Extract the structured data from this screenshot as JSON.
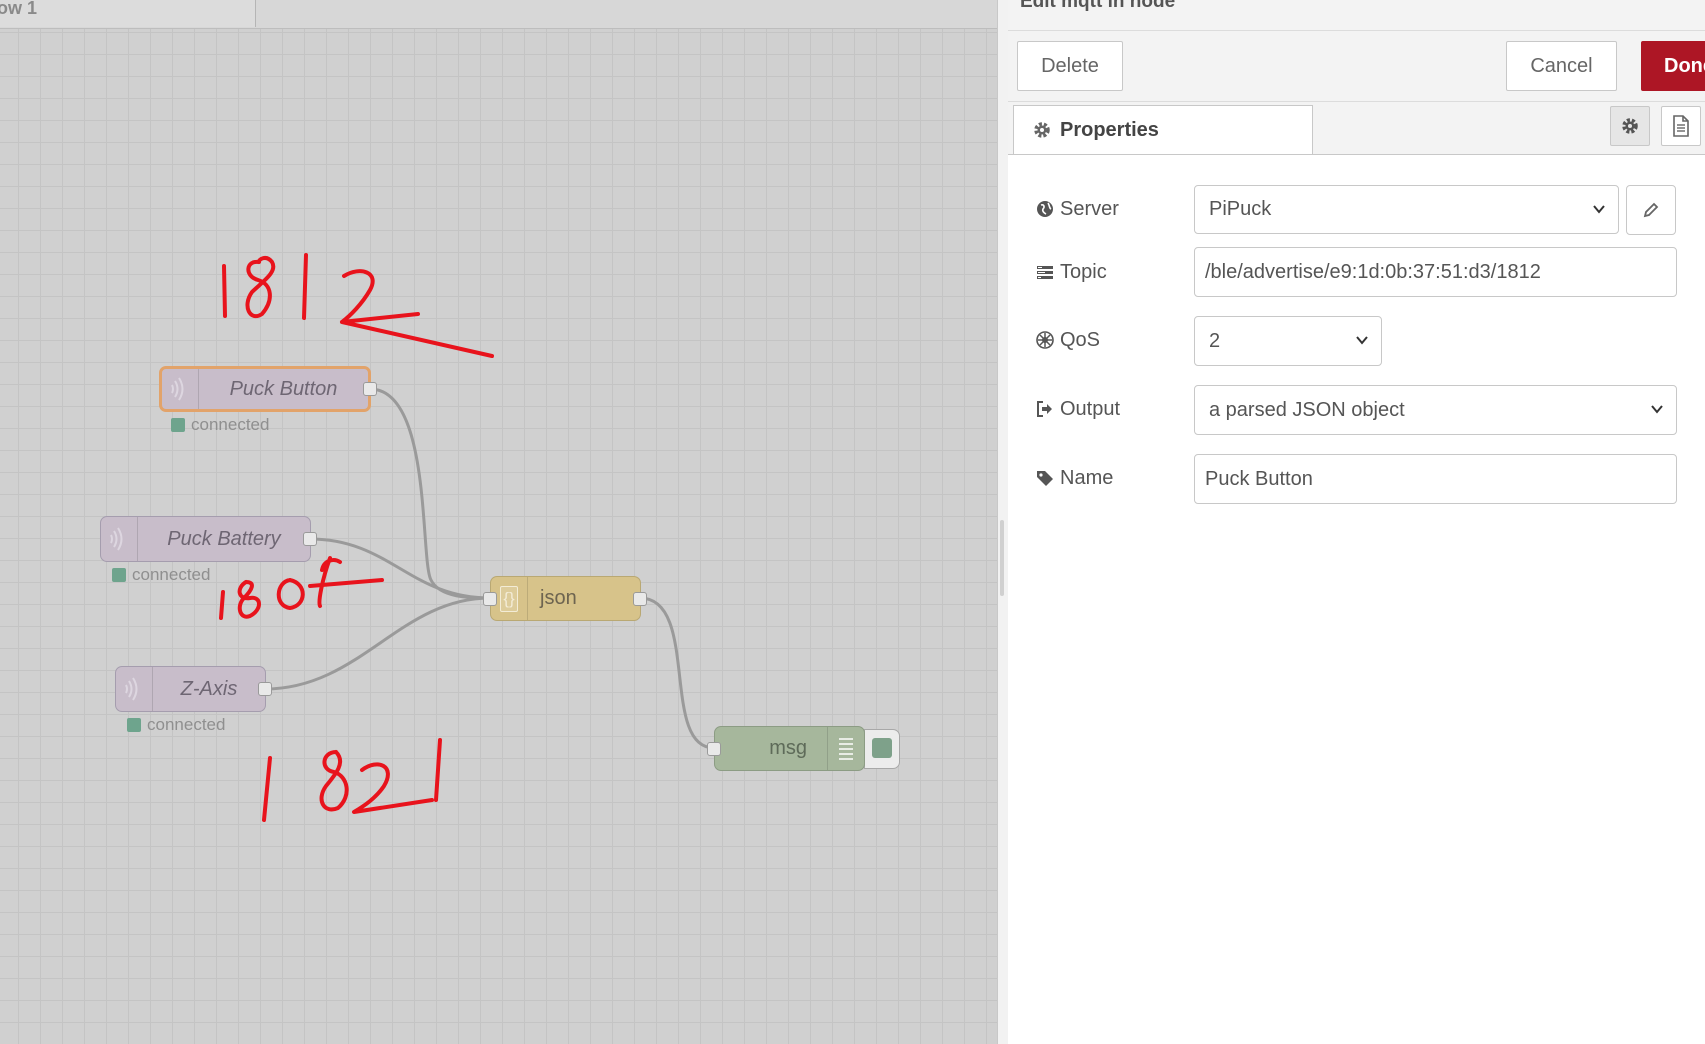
{
  "workspace": {
    "flow_tab_label": "ow 1",
    "nodes": {
      "puck_button": {
        "label": "Puck Button",
        "status": "connected"
      },
      "puck_battery": {
        "label": "Puck Battery",
        "status": "connected"
      },
      "z_axis": {
        "label": "Z-Axis",
        "status": "connected"
      },
      "json": {
        "label": "json",
        "icon": "{}"
      },
      "msg": {
        "label": "msg"
      }
    },
    "annotations": {
      "a1": "1812",
      "a2": "180f",
      "a3": "1821"
    }
  },
  "tray": {
    "title": "Edit mqtt in node",
    "toolbar": {
      "delete_label": "Delete",
      "cancel_label": "Cancel",
      "done_label": "Done"
    },
    "tabs": {
      "properties_label": "Properties"
    },
    "form": {
      "server": {
        "label": "Server",
        "value": "PiPuck"
      },
      "topic": {
        "label": "Topic",
        "value": "/ble/advertise/e9:1d:0b:37:51:d3/1812"
      },
      "qos": {
        "label": "QoS",
        "value": "2"
      },
      "output": {
        "label": "Output",
        "value": "a parsed JSON object"
      },
      "name": {
        "label": "Name",
        "value": "Puck Button"
      }
    }
  },
  "colors": {
    "done_button": "#ad1625",
    "ink": "#e8131c",
    "selected_node_border": "#e2a36a"
  }
}
